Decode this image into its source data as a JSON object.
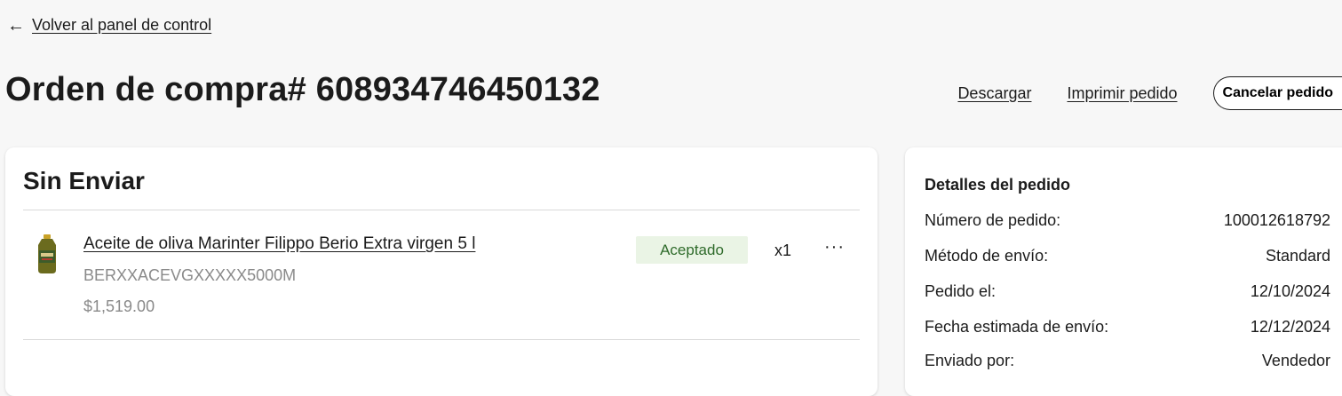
{
  "nav": {
    "back_arrow": "←",
    "back_label": "Volver al panel de control"
  },
  "header": {
    "title": "Orden de compra# 608934746450132",
    "download_label": "Descargar",
    "print_label": "Imprimir pedido",
    "cancel_label": "Cancelar pedido"
  },
  "shipment": {
    "status_title": "Sin Enviar",
    "items": [
      {
        "name": "Aceite de oliva Marinter Filippo Berio Extra virgen 5 l",
        "sku": "BERXXACEVGXXXXX5000M",
        "price": "$1,519.00",
        "status": "Aceptado",
        "quantity": "x1",
        "more": "···",
        "image_icon": "olive-oil-bottle-icon"
      }
    ]
  },
  "details": {
    "title": "Detalles del pedido",
    "rows": [
      {
        "label": "Número de pedido:",
        "value": "100012618792"
      },
      {
        "label": "Método de envío:",
        "value": "Standard"
      },
      {
        "label": "Pedido el:",
        "value": "12/10/2024"
      },
      {
        "label": "Fecha estimada de envío:",
        "value": "12/12/2024"
      },
      {
        "label": "Enviado por:",
        "value": "Vendedor"
      }
    ]
  },
  "colors": {
    "background": "#f7f7f7",
    "card": "#ffffff",
    "status_badge_bg": "#eaf4e5",
    "status_badge_text": "#2f6b2b",
    "muted_text": "#8a8a8a"
  }
}
